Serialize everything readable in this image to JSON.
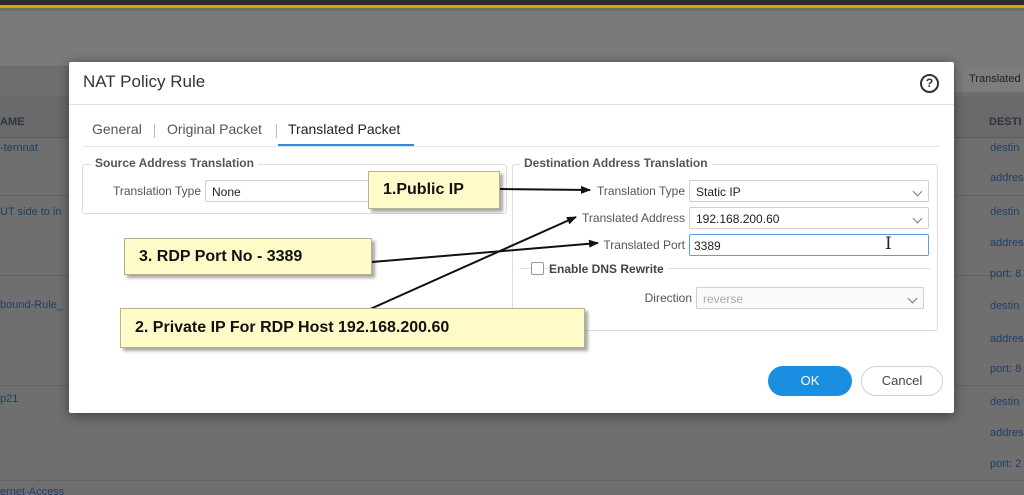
{
  "background": {
    "header_columns": [
      "AME",
      "DESTI"
    ],
    "right_tab": "Translated",
    "left_cells": [
      "-ternnat",
      "UT side to in",
      "bound-Rule_",
      "p21",
      "ernet-Access"
    ],
    "right_cells": [
      "destin",
      "addres",
      "destin",
      "addres",
      "port: 8",
      "destin",
      "addres",
      "port: 8",
      "destin",
      "addres",
      "port: 2"
    ]
  },
  "dialog": {
    "title": "NAT Policy Rule",
    "help_icon": "?",
    "tabs": [
      {
        "label": "General",
        "active": false
      },
      {
        "label": "Original Packet",
        "active": false
      },
      {
        "label": "Translated Packet",
        "active": true
      }
    ],
    "source": {
      "title": "Source Address Translation",
      "translation_type_label": "Translation Type",
      "translation_type_value": "None"
    },
    "destination": {
      "title": "Destination Address Translation",
      "translation_type_label": "Translation Type",
      "translation_type_value": "Static IP",
      "translated_address_label": "Translated Address",
      "translated_address_value": "192.168.200.60",
      "translated_port_label": "Translated Port",
      "translated_port_value": "3389",
      "dns_rewrite_label": "Enable DNS Rewrite",
      "dns_rewrite_checked": false,
      "direction_label": "Direction",
      "direction_value": "reverse"
    },
    "ok_label": "OK",
    "cancel_label": "Cancel"
  },
  "annotations": {
    "callout1": "1.Public IP",
    "callout2": "2. Private IP For RDP Host 192.168.200.60",
    "callout3": "3. RDP Port No - 3389"
  },
  "colors": {
    "accent": "#1a8ee1",
    "callout_bg": "#fffbc8"
  }
}
